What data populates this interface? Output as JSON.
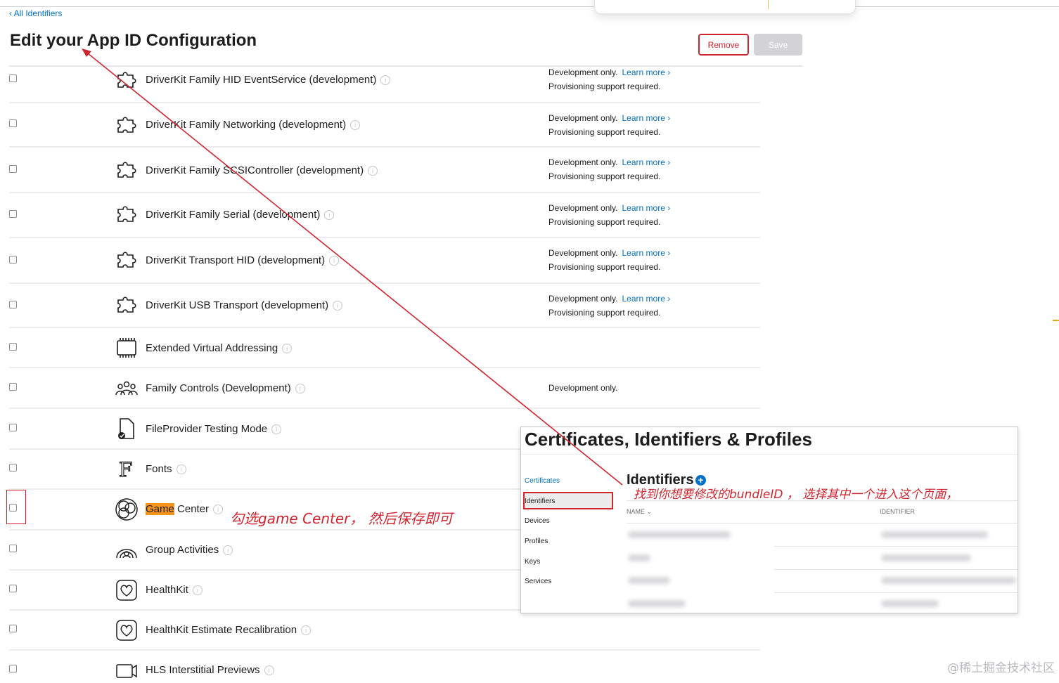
{
  "back_link": "‹ All Identifiers",
  "page_title": "Edit your App ID Configuration",
  "buttons": {
    "remove": "Remove",
    "save": "Save"
  },
  "capabilities": [
    {
      "label": "DriverKit Family HID EventService (development)",
      "icon": "puzzle-icon",
      "note": "Development only.",
      "learn": "Learn more ›",
      "note2": "Provisioning support required."
    },
    {
      "label": "DriverKit Family Networking (development)",
      "icon": "puzzle-icon",
      "note": "Development only.",
      "learn": "Learn more ›",
      "note2": "Provisioning support required."
    },
    {
      "label": "DriverKit Family SCSIController (development)",
      "icon": "puzzle-icon",
      "note": "Development only.",
      "learn": "Learn more ›",
      "note2": "Provisioning support required."
    },
    {
      "label": "DriverKit Family Serial (development)",
      "icon": "puzzle-icon",
      "note": "Development only.",
      "learn": "Learn more ›",
      "note2": "Provisioning support required."
    },
    {
      "label": "DriverKit Transport HID (development)",
      "icon": "puzzle-icon",
      "note": "Development only.",
      "learn": "Learn more ›",
      "note2": "Provisioning support required."
    },
    {
      "label": "DriverKit USB Transport (development)",
      "icon": "puzzle-icon",
      "note": "Development only.",
      "learn": "Learn more ›",
      "note2": "Provisioning support required."
    },
    {
      "label": "Extended Virtual Addressing",
      "icon": "memory-chip-icon"
    },
    {
      "label": "Family Controls (Development)",
      "icon": "family-icon",
      "note": "Development only."
    },
    {
      "label": "FileProvider Testing Mode",
      "icon": "document-check-icon"
    },
    {
      "label": "Fonts",
      "icon": "font-icon"
    },
    {
      "label_highlight": "Game",
      "label_rest": " Center",
      "icon": "game-center-icon"
    },
    {
      "label": "Group Activities",
      "icon": "group-activities-icon"
    },
    {
      "label": "HealthKit",
      "icon": "heart-icon"
    },
    {
      "label": "HealthKit Estimate Recalibration",
      "icon": "heart-icon"
    },
    {
      "label": "HLS Interstitial Previews",
      "icon": "video-icon"
    }
  ],
  "annotations": {
    "game_center": "勾选game Center，  然后保存即可",
    "find_bundle": "找到你想要修改的bundleID  ，  选择其中一个进入这个页面，"
  },
  "inset": {
    "title": "Certificates, Identifiers & Profiles",
    "sidebar": [
      "Certificates",
      "Identifiers",
      "Devices",
      "Profiles",
      "Keys",
      "Services"
    ],
    "section_title": "Identifiers",
    "columns": [
      "NAME ⌄",
      "IDENTIFIER"
    ]
  },
  "watermark": "@稀土掘金技术社区",
  "colors": {
    "accent": "#0070c9",
    "annotation_red": "#d0252f",
    "highlight": "#f7941d"
  }
}
